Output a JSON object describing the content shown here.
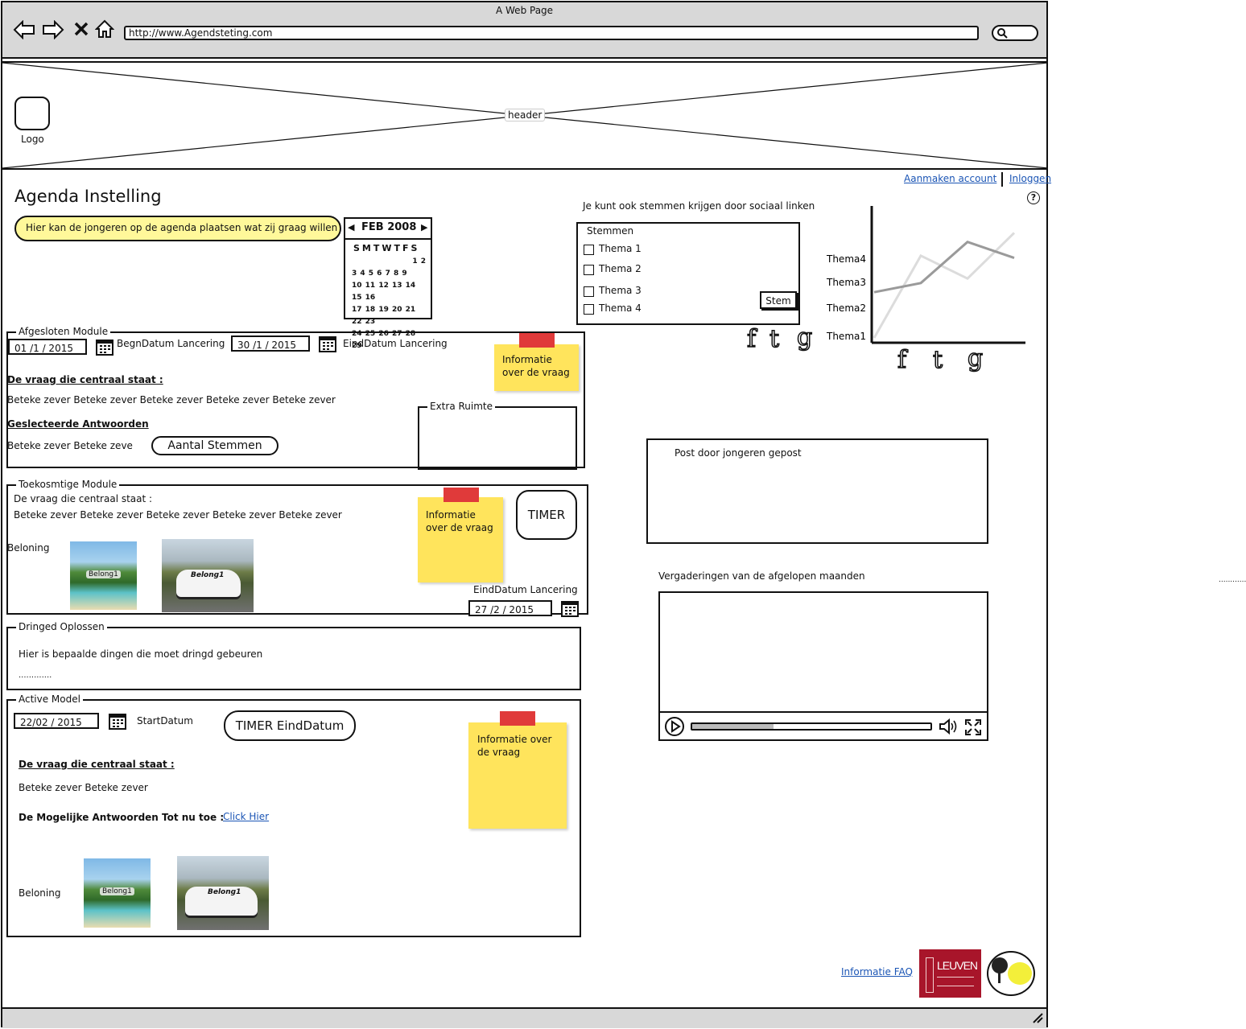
{
  "browser": {
    "title": "A Web Page",
    "url": "http://www.Agendsteting.com"
  },
  "header": {
    "logo_label": "Logo",
    "placeholder_label": "header"
  },
  "top_links": {
    "create_account": "Aanmaken account",
    "login": "Inloggen"
  },
  "page": {
    "title": "Agenda Instelling",
    "callout": "Hier kan de jongeren op de agenda plaatsen wat zij graag willen"
  },
  "calendar": {
    "month_label": "FEB 2008",
    "weekdays": "SMTWTFS"
  },
  "voting": {
    "intro": "Je kunt ook stemmen krijgen door sociaal linken",
    "group_label": "Stemmen",
    "options": [
      "Thema 1",
      "Thema 2",
      "Thema 3",
      "Thema 4"
    ],
    "button": "Stem"
  },
  "chart_data": {
    "type": "line",
    "categories": [
      "Thema4",
      "Thema3",
      "Thema2",
      "Thema1"
    ],
    "series": [
      {
        "values": [
          2,
          2.4,
          4.2,
          3.5
        ]
      },
      {
        "values": [
          0,
          3.6,
          2.6,
          4.6
        ]
      }
    ],
    "colors": [
      "#9a9a9a",
      "#dcdcdc"
    ]
  },
  "afgesloten": {
    "group_label": "Afgesloten Module",
    "start_date": "01 /1  / 2015",
    "start_label": "BegnDatum Lancering",
    "end_date": "30 /1  / 2015",
    "end_label": "EindDatum Lancering",
    "question_heading": "De vraag die centraal staat :",
    "question_text": "Beteke zever Beteke zever Beteke zever Beteke zever Beteke zever",
    "answers_heading": "Geslecteerde Antwoorden",
    "answers_text": "Beteke zever Beteke zeve",
    "votes_button": "Aantal Stemmen",
    "note": "Informatie over de vraag",
    "extra_label": "Extra Ruimte"
  },
  "toekomstige": {
    "group_label": "Toekosmtige Module",
    "question_heading": "De vraag die centraal staat :",
    "question_text": "Beteke zever Beteke zever Beteke zever Beteke zever Beteke zever",
    "reward_label": "Beloning",
    "img1_label": "Belong1",
    "img2_label": "Belong1",
    "note": "Informatie over de vraag",
    "timer": "TIMER",
    "end_label": "EindDatum Lancering",
    "end_date": "27 /2  / 2015"
  },
  "dringend": {
    "group_label": "Dringed Oplossen",
    "text": "Hier is bepaalde dingen die moet dringd gebeuren",
    "dots": "............."
  },
  "active": {
    "group_label": "Active Model",
    "date": "22/02  / 2015",
    "start_label": "StartDatum",
    "timer": "TIMER EindDatum",
    "question_heading": "De vraag die centraal staat :",
    "question_text": "Beteke zever Beteke zever",
    "answers_heading": "De Mogelijke Antwoorden Tot nu toe :",
    "answers_link": "Click Hier",
    "reward_label": "Beloning",
    "img1_label": "Belong1",
    "img2_label": "Belong1",
    "note": "Informatie over de vraag"
  },
  "posts": {
    "label": "Post door jongeren gepost"
  },
  "video": {
    "label": "Vergaderingen van de afgelopen maanden",
    "progress": 0.34
  },
  "side_dots": "............",
  "footer": {
    "faq_link": "Informatie FAQ",
    "leuven_label": "LEUVEN"
  }
}
